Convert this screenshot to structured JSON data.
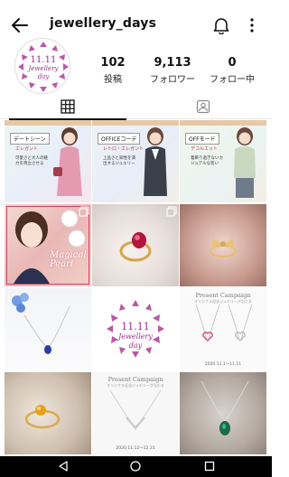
{
  "profile": {
    "username": "jewellery_days",
    "avatar_line1": "11.11",
    "avatar_line2": "Jewellery",
    "avatar_line3": "day"
  },
  "stats": [
    {
      "num": "102",
      "label": "投稿"
    },
    {
      "num": "9,113",
      "label": "フォロワー"
    },
    {
      "num": "0",
      "label": "フォロー中"
    }
  ],
  "tabs": [
    "grid-icon",
    "tagged-icon"
  ],
  "posts": {
    "card1": {
      "tag": "デートシーン",
      "note": "エレガント",
      "text": "可愛さと大人の魅力を両立させる"
    },
    "card2": {
      "tag": "OFFICEコーデ",
      "note": "レトロ・エレガント",
      "text": "上品さと知性を演出するジュエリー"
    },
    "card3": {
      "tag": "OFFモード",
      "note": "デコルエット",
      "text": "着飾り過ぎないカジュアルな装い"
    },
    "magical": "Magical Pearl",
    "logo_line1": "11.11",
    "logo_line2": "Jewellery",
    "logo_line3": "day",
    "campaign1_title": "Present Campaign",
    "campaign1_sub": "オリジナル記念ジュエリーが当たる",
    "campaign1_date": "2020.11.1～11.11",
    "campaign2_title": "Present Campaign",
    "campaign2_sub": "オリジナル記念ジュエリーが当たる",
    "campaign2_date": "2020.11.12～12.31"
  },
  "colors": {
    "brand": "#9b2d8a",
    "nav_bg": "#000000"
  }
}
